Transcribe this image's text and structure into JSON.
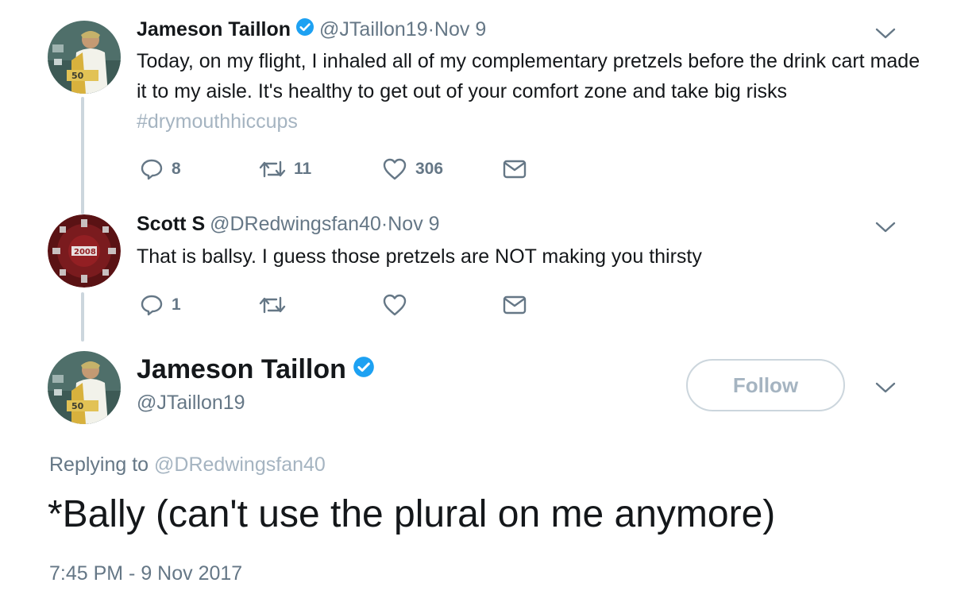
{
  "tweet1": {
    "author_name": "Jameson Taillon",
    "handle": "@JTaillon19",
    "time": "·Nov 9",
    "text_main": "Today, on my flight, I inhaled all of my complementary pretzels before the drink cart made it to my aisle. It's healthy to get out of your comfort zone and take big risks ",
    "hashtag": "#drymouthhiccups",
    "reply_count": "8",
    "retweet_count": "11",
    "like_count": "306"
  },
  "tweet2": {
    "author_name": "Scott S",
    "handle": "@DRedwingsfan40",
    "time": "·Nov 9",
    "text": "That is ballsy. I guess those pretzels are NOT making you thirsty",
    "reply_count": "1",
    "retweet_count": "",
    "like_count": ""
  },
  "main_tweet": {
    "author_name": "Jameson Taillon",
    "handle": "@JTaillon19",
    "follow_label": "Follow",
    "replying_prefix": "Replying to ",
    "replying_to": "@DRedwingsfan40",
    "text": "*Bally (can't use the plural on me anymore)",
    "timestamp": "7:45 PM - 9 Nov 2017"
  },
  "colors": {
    "text": "#14171a",
    "secondary": "#657786",
    "verified": "#1da1f2",
    "muted_link": "#a5b4c1",
    "border": "#ccd6dd"
  },
  "icons": [
    "verified-badge-icon",
    "chevron-down-icon",
    "reply-icon",
    "retweet-icon",
    "like-icon",
    "direct-message-icon"
  ]
}
